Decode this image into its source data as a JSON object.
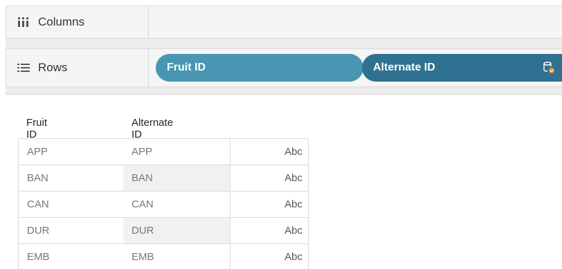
{
  "shelves": {
    "columns": {
      "label": "Columns",
      "icon": "columns-icon",
      "pills": []
    },
    "rows": {
      "label": "Rows",
      "icon": "rows-icon",
      "pills": [
        {
          "label": "Fruit ID",
          "color": "#4996b2"
        },
        {
          "label": "Alternate ID",
          "color": "#2f7190",
          "icon": "database-linked-icon"
        }
      ]
    }
  },
  "table": {
    "headers": [
      "Fruit ID",
      "Alternate ID"
    ],
    "rows": [
      {
        "fruit_id": "APP",
        "alternate_id": "APP",
        "mark": "Abc"
      },
      {
        "fruit_id": "BAN",
        "alternate_id": "BAN",
        "mark": "Abc"
      },
      {
        "fruit_id": "CAN",
        "alternate_id": "CAN",
        "mark": "Abc"
      },
      {
        "fruit_id": "DUR",
        "alternate_id": "DUR",
        "mark": "Abc"
      },
      {
        "fruit_id": "EMB",
        "alternate_id": "EMB",
        "mark": "Abc"
      }
    ]
  }
}
